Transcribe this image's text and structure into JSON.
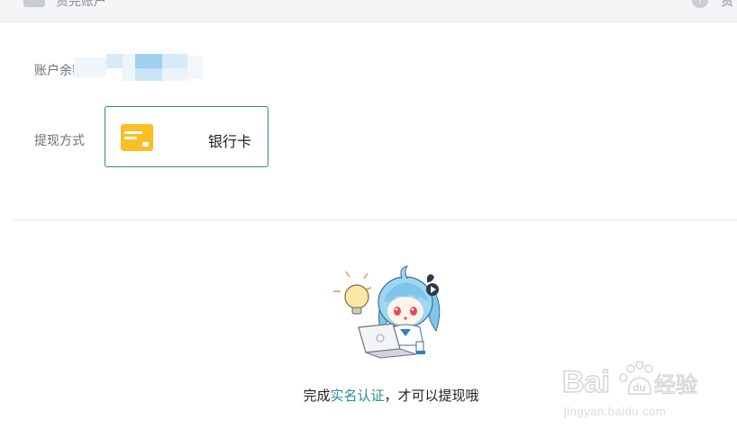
{
  "header": {
    "title": "资完账户",
    "right_text": "资",
    "help_icon": "help-circle-icon"
  },
  "balance": {
    "label": "账户余额"
  },
  "withdraw_method": {
    "label": "提现方式",
    "option_label": "银行卡",
    "option_icon": "bank-card-icon",
    "accent_color": "#2d8a9c",
    "icon_color": "#fbbf24"
  },
  "notice": {
    "prefix": "完成",
    "link_text": "实名认证",
    "suffix": "，才可以提现哦"
  },
  "watermark": {
    "text": "jingyan.baidu.com"
  }
}
